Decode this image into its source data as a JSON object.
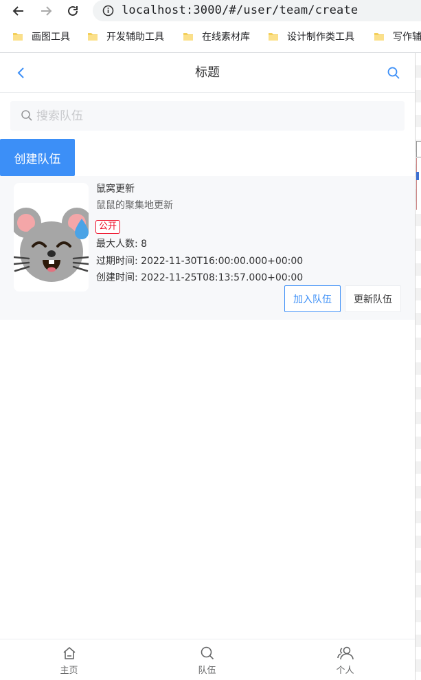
{
  "browser": {
    "url": "localhost:3000/#/user/team/create",
    "bookmarks": [
      {
        "label": "画图工具"
      },
      {
        "label": "开发辅助工具"
      },
      {
        "label": "在线素材库"
      },
      {
        "label": "设计制作类工具"
      },
      {
        "label": "写作辅"
      }
    ],
    "icons": {
      "back": "arrow-left-icon",
      "forward": "arrow-right-icon",
      "reload": "reload-icon",
      "info": "info-icon",
      "folder": "folder-icon"
    }
  },
  "navbar": {
    "title": "标题",
    "left_icon": "chevron-left-icon",
    "right_icon": "search-icon",
    "accent": "#3c8ff7"
  },
  "search": {
    "placeholder": "搜索队伍",
    "value": ""
  },
  "create_button": {
    "label": "创建队伍"
  },
  "teams": [
    {
      "name": "鼠窝更新",
      "description": "鼠鼠的聚集地更新",
      "tag": "公开",
      "max_members": "最大人数: 8",
      "expire_time": "过期时间: 2022-11-30T16:00:00.000+00:00",
      "create_time": "创建时间: 2022-11-25T08:13:57.000+00:00",
      "join_label": "加入队伍",
      "update_label": "更新队伍",
      "avatar": "grinning-mouse-sweat-emoji"
    }
  ],
  "tabbar": [
    {
      "label": "主页",
      "icon": "home-icon"
    },
    {
      "label": "队伍",
      "icon": "search-icon"
    },
    {
      "label": "个人",
      "icon": "friends-icon"
    }
  ],
  "colors": {
    "primary": "#3c8ff7",
    "tag_red": "#ee0a24",
    "card_bg": "#f7f8fa"
  }
}
